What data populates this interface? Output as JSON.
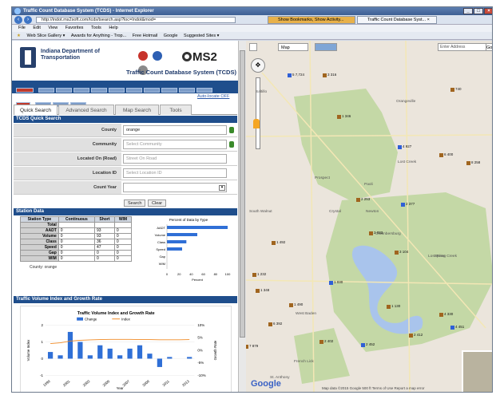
{
  "window": {
    "title": "Traffic Count Database System (TCDS) - Internet Explorer",
    "url": "http://indot.ms2soft.com/tcds/tsearch.asp?loc=Indot&mod=",
    "tabs": [
      "Show Bookmarks, Show Activity...",
      "Traffic Count Database Syst... ×"
    ]
  },
  "menubar": [
    "File",
    "Edit",
    "View",
    "Favorites",
    "Tools",
    "Help"
  ],
  "favorites": [
    "Web Slice Gallery ▾",
    "Awards for Anything - Trop...",
    "Free Hotmail",
    "Google",
    "Suggested Sites ▾"
  ],
  "header": {
    "org_line1": "Indiana Department of",
    "org_line2": "Transportation",
    "brand": "MS2",
    "system_title": "Traffic Count Database System (TCDS)",
    "nav_home": "Home",
    "nav_login": "Login",
    "autolink": "Auto-locate OFF"
  },
  "search_tabs": [
    "Quick Search",
    "Advanced Search",
    "Map Search",
    "Tools"
  ],
  "quick_search": {
    "heading": "TCDS Quick Search",
    "fields": [
      {
        "label": "County",
        "value": "orange",
        "placeholder": ""
      },
      {
        "label": "Community",
        "value": "",
        "placeholder": "Select Community"
      },
      {
        "label": "Located On (Road)",
        "value": "",
        "placeholder": "Street On Road"
      },
      {
        "label": "Location ID",
        "value": "",
        "placeholder": "Select Location ID"
      },
      {
        "label": "Count Year",
        "value": "",
        "placeholder": ""
      }
    ],
    "search_button": "Search",
    "clear_button": "Clear"
  },
  "station_data": {
    "heading": "Station Data",
    "columns": [
      "Station Type",
      "Continuous",
      "Short",
      "WIM"
    ],
    "rows": [
      {
        "type": "Total",
        "continuous": "",
        "short": "",
        "wim": ""
      },
      {
        "type": "AADT",
        "continuous": "0",
        "short": "93",
        "wim": "0"
      },
      {
        "type": "Volume",
        "continuous": "0",
        "short": "93",
        "wim": "0"
      },
      {
        "type": "Class",
        "continuous": "0",
        "short": "36",
        "wim": "0"
      },
      {
        "type": "Speed",
        "continuous": "0",
        "short": "47",
        "wim": "0"
      },
      {
        "type": "Gap",
        "continuous": "0",
        "short": "0",
        "wim": "0"
      },
      {
        "type": "WIM",
        "continuous": "0",
        "short": "0",
        "wim": "0"
      }
    ],
    "county_note": "County: orange"
  },
  "chart_data": [
    {
      "type": "bar",
      "title": "Percent of Data by Type",
      "orientation": "horizontal",
      "categories": [
        "AADT",
        "Volume",
        "Class",
        "Speed",
        "Gap",
        "WIM"
      ],
      "values": [
        100,
        50,
        32,
        25,
        0,
        0
      ],
      "xlabel": "Percent",
      "xticks": [
        "0",
        "20",
        "40",
        "60",
        "80",
        "100"
      ],
      "xlim": [
        0,
        100
      ]
    },
    {
      "type": "bar",
      "title": "Traffic Volume Index and Growth Rate",
      "legend": [
        "Change",
        "Index"
      ],
      "categories": [
        "1999",
        "2001",
        "2003",
        "2005",
        "2007",
        "2009",
        "2011",
        "2013"
      ],
      "series": [
        {
          "name": "Change",
          "values": [
            0.4,
            0.2,
            1.6,
            1.0,
            0.2,
            0.8,
            0.6,
            0.2,
            0.6,
            0.8,
            0.3,
            -0.5,
            0.1,
            0.0,
            0.1
          ]
        }
      ],
      "index_line": [
        0.9,
        0.95,
        1.05,
        1.1,
        1.12,
        1.14,
        1.15,
        1.15,
        1.15,
        1.14,
        1.14,
        1.13,
        1.13,
        1.13,
        1.14
      ],
      "ylabel": "Volume Index",
      "y2label": "Growth Rate",
      "yticks": [
        "2",
        "1",
        "0",
        "-1"
      ],
      "y2ticks": [
        "10%",
        "5%",
        "0%",
        "-5%",
        "-10%"
      ],
      "xlabel": "Year",
      "ylim": [
        -1,
        2
      ]
    }
  ],
  "growth": {
    "heading": "Traffic Volume Index and Growth Rate"
  },
  "map": {
    "type_label": "Map",
    "address_placeholder": "Enter Address",
    "go_label": "Go",
    "copyright": "Map data ©2015 Google   500 ft   Terms of Use   Report a map error",
    "places": [
      "Saltillo",
      "Orangeville",
      "Prospect",
      "Crystal",
      "Paoli",
      "Newton",
      "Chambersburg",
      "Lost River",
      "French Lick",
      "West Baden",
      "South Walnut",
      "Spring Creek",
      "St. Anthony",
      "Lost Creek"
    ],
    "labels": [
      "5 7,724",
      "3 316",
      "740",
      "1 346",
      "4 927",
      "6 400",
      "8 258",
      "2 253",
      "2 377",
      "1 492",
      "1 232",
      "2 412",
      "4 451",
      "1 130",
      "4 330",
      "2 402",
      "2 452",
      "6 392",
      "1 348",
      "7 879",
      "1 030",
      "1 490",
      "2 033",
      "3 104"
    ]
  }
}
